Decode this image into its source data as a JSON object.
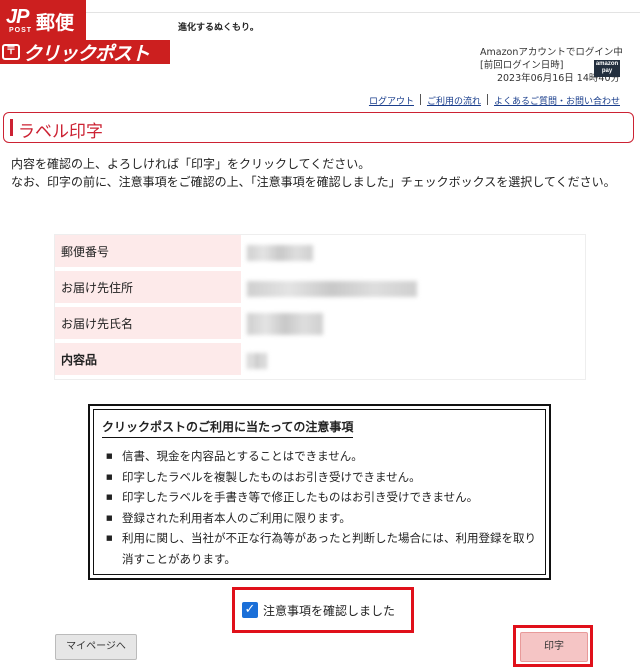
{
  "header": {
    "brand_mark": "JP",
    "brand_post": "POST",
    "brand_name": "郵便局",
    "tagline": "進化するぬくもり。",
    "service_logo": "クリックポスト",
    "service_icon": "〒",
    "login_method": "Amazonアカウントでログイン中",
    "last_login_label": "[前回ログイン日時]",
    "last_login_time": "2023年06月16日 14時40分",
    "amazon_badge_line1": "amazon",
    "amazon_badge_line2": "pay",
    "links": {
      "logout": "ログアウト",
      "usage_flow": "ご利用の流れ",
      "faq": "よくあるご質問・お問い合わせ"
    }
  },
  "page": {
    "title": "ラベル印字",
    "instruction_line1": "内容を確認の上、よろしければ「印字」をクリックしてください。",
    "instruction_line2": "なお、印字の前に、注意事項をご確認の上、「注意事項を確認しました」チェックボックスを選択してください。"
  },
  "address_table": {
    "rows": [
      {
        "label": "郵便番号"
      },
      {
        "label": "お届け先住所"
      },
      {
        "label": "お届け先氏名"
      },
      {
        "label": "内容品"
      }
    ]
  },
  "notice": {
    "title": "クリックポストのご利用に当たっての注意事項",
    "items": [
      "信書、現金を内容品とすることはできません。",
      "印字したラベルを複製したものはお引き受けできません。",
      "印字したラベルを手書き等で修正したものはお引き受けできません。",
      "登録された利用者本人のご利用に限ります。",
      "利用に関し、当社が不正な行為等があったと判断した場合には、利用登録を取り消すことがあります。"
    ]
  },
  "confirm": {
    "label": "注意事項を確認しました",
    "checked": true
  },
  "buttons": {
    "mypage": "マイページへ",
    "print": "印字"
  },
  "colors": {
    "brand_red": "#cc1f1f",
    "title_red": "#cc2233",
    "highlight_red": "#e0101a",
    "label_bg": "#fdeaea",
    "checkbox_blue": "#1a6fd8"
  }
}
